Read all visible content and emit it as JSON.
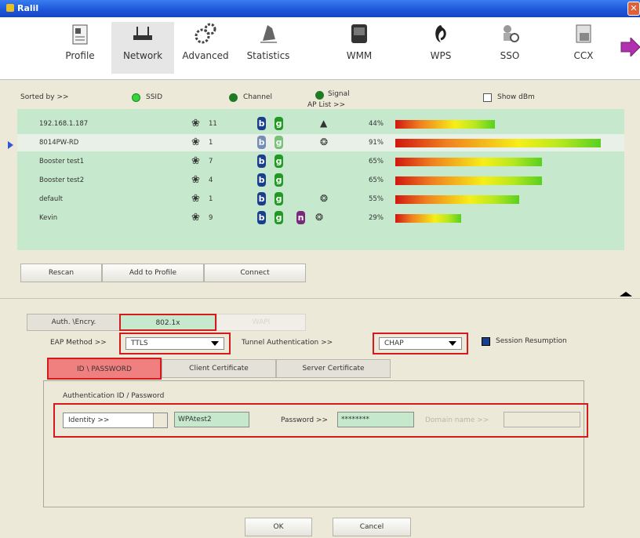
{
  "window": {
    "title": "Ralil"
  },
  "toolbar": {
    "items": [
      {
        "label": "Profile",
        "icon": "profile-icon"
      },
      {
        "label": "Network",
        "icon": "network-icon",
        "selected": true
      },
      {
        "label": "Advanced",
        "icon": "advanced-icon"
      },
      {
        "label": "Statistics",
        "icon": "statistics-icon"
      },
      {
        "label": "WMM",
        "icon": "wmm-icon"
      },
      {
        "label": "WPS",
        "icon": "wps-icon"
      },
      {
        "label": "SSO",
        "icon": "sso-icon"
      },
      {
        "label": "CCX",
        "icon": "ccx-icon"
      }
    ]
  },
  "sort": {
    "label": "Sorted by >>",
    "ssid": "SSID",
    "channel": "Channel",
    "signal": "Signal",
    "show_dbm": "Show dBm",
    "ap_list": "AP List >>"
  },
  "ap_list": [
    {
      "ssid": "192.168.1.187",
      "channel": "11",
      "modes": [
        "b",
        "g"
      ],
      "security": "lock",
      "signal": "44%",
      "level": 44,
      "selected": false
    },
    {
      "ssid": "8014PW-RD",
      "channel": "1",
      "modes": [
        "b",
        "g"
      ],
      "security": "wps",
      "signal": "91%",
      "level": 91,
      "selected": true
    },
    {
      "ssid": "Booster test1",
      "channel": "7",
      "modes": [
        "b",
        "g"
      ],
      "security": "",
      "signal": "65%",
      "level": 65,
      "selected": false
    },
    {
      "ssid": "Booster test2",
      "channel": "4",
      "modes": [
        "b",
        "g"
      ],
      "security": "",
      "signal": "65%",
      "level": 65,
      "selected": false
    },
    {
      "ssid": "default",
      "channel": "1",
      "modes": [
        "b",
        "g"
      ],
      "security": "wps",
      "signal": "55%",
      "level": 55,
      "selected": false
    },
    {
      "ssid": "Kevin",
      "channel": "9",
      "modes": [
        "b",
        "g",
        "n"
      ],
      "security": "wps",
      "signal": "29%",
      "level": 29,
      "selected": false
    }
  ],
  "buttons": {
    "rescan": "Rescan",
    "add_to_profile": "Add to Profile",
    "connect": "Connect",
    "ok": "OK",
    "cancel": "Cancel"
  },
  "auth": {
    "auth_encry_tab": "Auth. \\Encry.",
    "x8021_tab": "802.1x",
    "wapi_tab": "WAPI",
    "eap_label": "EAP Method >>",
    "eap_value": "TTLS",
    "tunnel_label": "Tunnel Authentication >>",
    "tunnel_value": "CHAP",
    "session_resumption": "Session Resumption",
    "subtabs": [
      "ID \\ PASSWORD",
      "Client Certificate",
      "Server Certificate"
    ],
    "group_title": "Authentication ID / Password",
    "identity_label": "Identity >>",
    "identity_value": "WPAtest2",
    "password_label": "Password >>",
    "password_value": "********",
    "domain_label": "Domain name >>"
  }
}
